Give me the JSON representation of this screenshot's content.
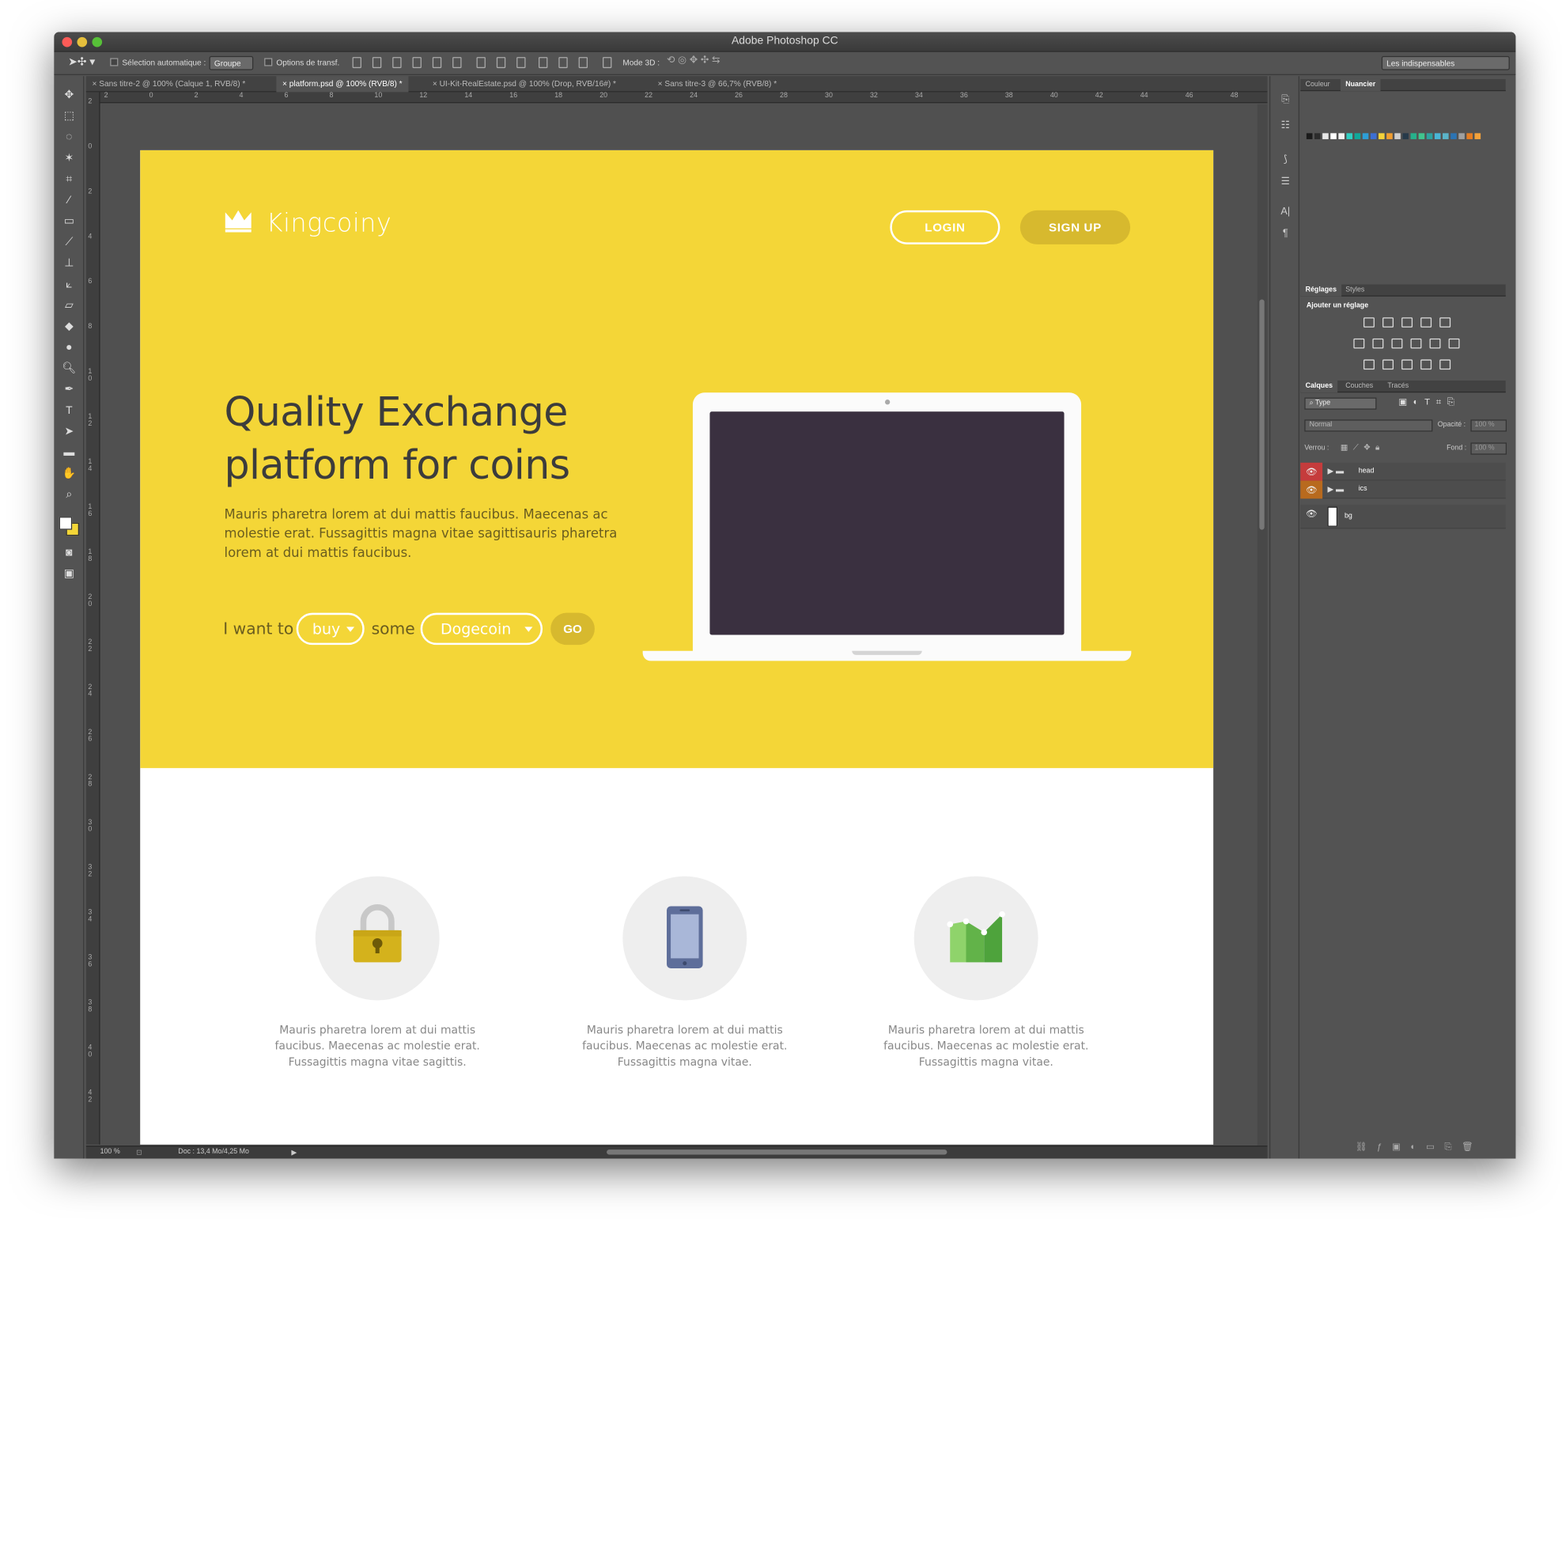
{
  "window": {
    "title": "Adobe Photoshop CC"
  },
  "options": {
    "auto_select": "Sélection automatique :",
    "auto_select_value": "Groupe",
    "transform_options": "Options de transf.",
    "mode3d": "Mode 3D :",
    "workspace": "Les indispensables"
  },
  "tabs": [
    "Sans titre-2 @ 100% (Calque 1, RVB/8) *",
    "platform.psd @ 100% (RVB/8) *",
    "UI-Kit-RealEstate.psd @ 100% (Drop, RVB/16#) *",
    "Sans titre-3 @ 66,7% (RVB/8) *"
  ],
  "ruler": {
    "h": [
      "2",
      "0",
      "2",
      "4",
      "6",
      "8",
      "10",
      "12",
      "14",
      "16",
      "18",
      "20",
      "22",
      "24",
      "26",
      "28",
      "30",
      "32",
      "34",
      "36",
      "38",
      "40",
      "42",
      "44",
      "46",
      "48"
    ],
    "v": [
      "2",
      "0",
      "2",
      "4",
      "6",
      "8",
      "10",
      "12",
      "14",
      "16",
      "18",
      "20",
      "22",
      "24",
      "26",
      "28",
      "30",
      "32",
      "34",
      "36",
      "38",
      "40",
      "42"
    ]
  },
  "status": {
    "zoom": "100 %",
    "doc": "Doc : 13,4 Mo/4,25 Mo"
  },
  "panels": {
    "color_tabs": [
      "Couleur",
      "Nuancier"
    ],
    "swatches": [
      "#1b1b1b",
      "#2c2c2c",
      "#e8e8e8",
      "#ffffff",
      "#f2f2f2",
      "#2fd0c3",
      "#10a89b",
      "#2d9ed7",
      "#3d6fd3",
      "#f5d23a",
      "#f29e2f",
      "#cfcfcf",
      "#273a4a",
      "#26b18b",
      "#41c58e",
      "#2ea3a0",
      "#49b6d6",
      "#5bb4c9",
      "#2c74b4",
      "#a0a0a0",
      "#e67e22",
      "#f3a23b"
    ],
    "adj_tabs": [
      "Réglages",
      "Styles"
    ],
    "adj_title": "Ajouter un réglage",
    "layer_tabs": [
      "Calques",
      "Couches",
      "Tracés"
    ],
    "layer_filter": "Type",
    "blend": "Normal",
    "opacity_label": "Opacité :",
    "opacity": "100 %",
    "lock_label": "Verrou :",
    "fill_label": "Fond :",
    "fill": "100 %",
    "layers": [
      {
        "name": "head",
        "color": "#c53c3c"
      },
      {
        "name": "ics",
        "color": "#b86a1e"
      },
      {
        "name": "bg",
        "color": ""
      }
    ]
  },
  "site": {
    "brand": "Kingcoiny",
    "login": "LOGIN",
    "signup": "SIGN UP",
    "headline_1": "Quality Exchange",
    "headline_2": "platform for coins",
    "lead": "Mauris pharetra lorem at dui mattis faucibus. Maecenas ac molestie erat. Fussagittis magna vitae sagittisauris pharetra lorem at dui mattis faucibus.",
    "want": "I want to",
    "action": "buy",
    "some": "some",
    "coin": "Dogecoin",
    "go": "GO",
    "features": [
      {
        "icon": "padlock-icon",
        "text": "Mauris pharetra lorem at dui mattis faucibus. Maecenas ac molestie erat. Fussagittis magna vitae sagittis."
      },
      {
        "icon": "smartphone-icon",
        "text": "Mauris pharetra lorem at dui mattis faucibus. Maecenas ac molestie erat. Fussagittis magna vitae."
      },
      {
        "icon": "chart-icon",
        "text": "Mauris pharetra lorem at dui mattis faucibus. Maecenas ac molestie erat. Fussagittis magna vitae."
      }
    ],
    "colors": {
      "yellow": "#f4d637",
      "dark_yellow": "#d7b92e",
      "screen": "#3a3040"
    }
  }
}
